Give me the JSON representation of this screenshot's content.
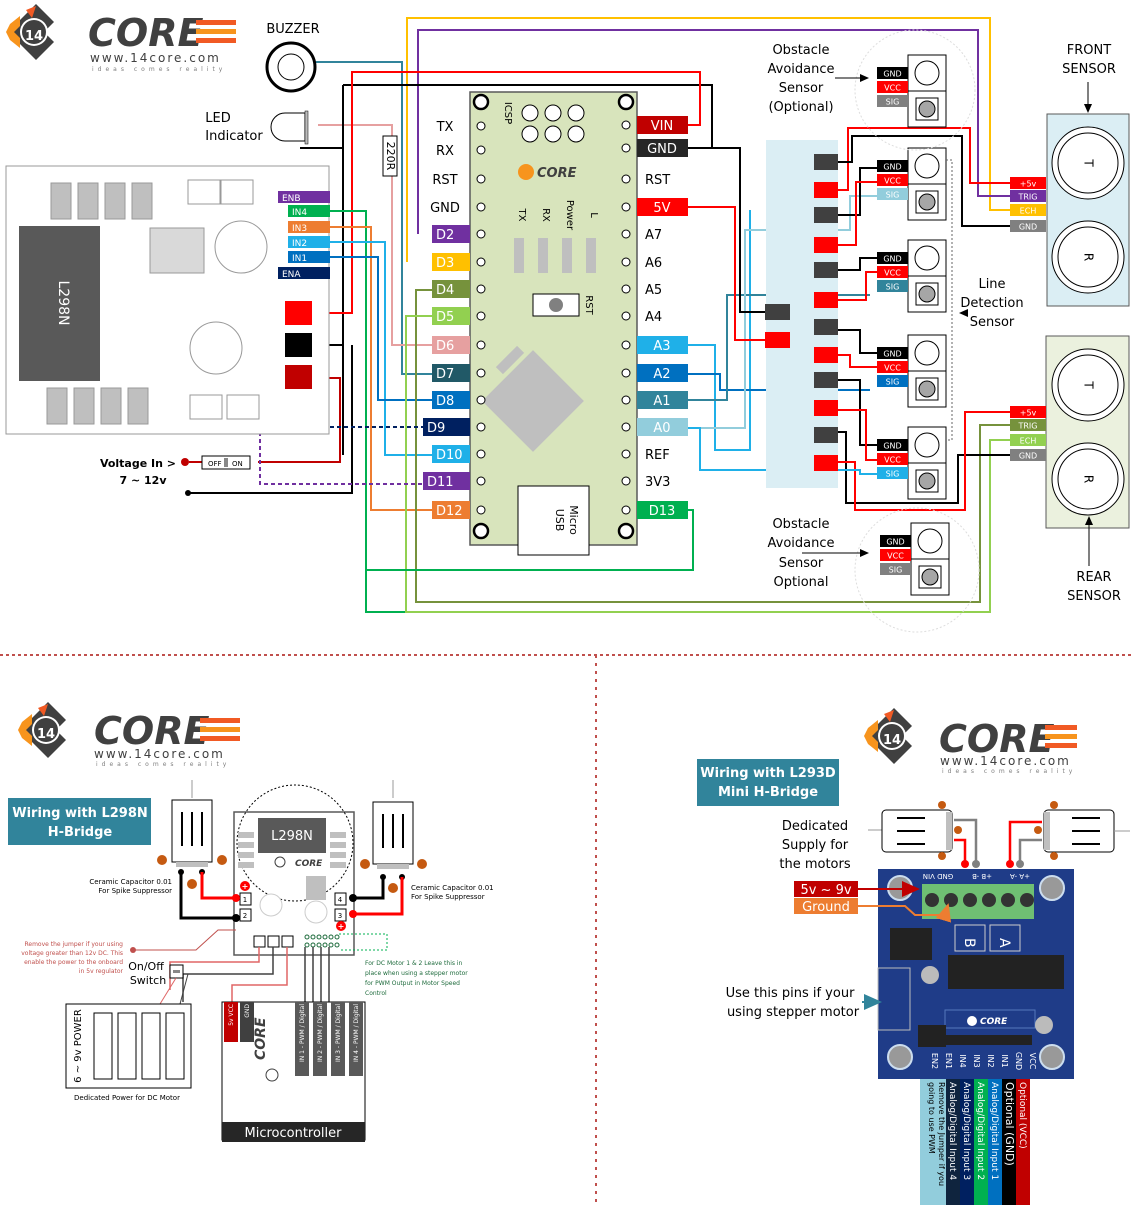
{
  "brand": {
    "name": "CORE",
    "prefix": "14",
    "url": "www.14core.com",
    "tagline": "ideas comes reality"
  },
  "top_diagram": {
    "buzzer_label": "BUZZER",
    "led_label_1": "LED",
    "led_label_2": "Indicator",
    "resistor_label": "220R",
    "driver_chip_label": "L298N",
    "driver_pins": [
      {
        "label": "ENB",
        "color": "#7030a0"
      },
      {
        "label": "IN4",
        "color": "#00b050"
      },
      {
        "label": "IN3",
        "color": "#ed7d31"
      },
      {
        "label": "IN2",
        "color": "#1fb0e8"
      },
      {
        "label": "IN1",
        "color": "#0070c0"
      },
      {
        "label": "ENA",
        "color": "#002060"
      }
    ],
    "voltage_in_1": "Voltage In >",
    "voltage_in_2": "7 ~ 12v",
    "switch_off": "OFF",
    "switch_on": "ON",
    "arduino": {
      "icsp": "ICSP",
      "left_plain": [
        "TX",
        "RX",
        "RST",
        "GND"
      ],
      "left_pins": [
        {
          "label": "D2",
          "color": "#7030a0"
        },
        {
          "label": "D3",
          "color": "#ffc000"
        },
        {
          "label": "D4",
          "color": "#76923c"
        },
        {
          "label": "D5",
          "color": "#92d050"
        },
        {
          "label": "D6",
          "color": "#e6a0a0"
        },
        {
          "label": "D7",
          "color": "#215967"
        },
        {
          "label": "D8",
          "color": "#0070c0"
        },
        {
          "label": "D9",
          "color": "#002060"
        },
        {
          "label": "D10",
          "color": "#1fb0e8"
        },
        {
          "label": "D11",
          "color": "#7030a0"
        },
        {
          "label": "D12",
          "color": "#ed7d31"
        }
      ],
      "right_pins": [
        {
          "label": "VIN",
          "color": "#c00000",
          "tagged": true
        },
        {
          "label": "GND",
          "color": "#262626",
          "tagged": true
        },
        {
          "label": "RST",
          "color": "",
          "tagged": false
        },
        {
          "label": "5V",
          "color": "#ff0000",
          "tagged": true
        },
        {
          "label": "A7",
          "color": "",
          "tagged": false
        },
        {
          "label": "A6",
          "color": "",
          "tagged": false
        },
        {
          "label": "A5",
          "color": "",
          "tagged": false
        },
        {
          "label": "A4",
          "color": "",
          "tagged": false
        },
        {
          "label": "A3",
          "color": "#1fb0e8",
          "tagged": true
        },
        {
          "label": "A2",
          "color": "#0070c0",
          "tagged": true
        },
        {
          "label": "A1",
          "color": "#31849b",
          "tagged": true
        },
        {
          "label": "A0",
          "color": "#92cddc",
          "tagged": true
        },
        {
          "label": "REF",
          "color": "",
          "tagged": false
        },
        {
          "label": "3V3",
          "color": "",
          "tagged": false
        },
        {
          "label": "D13",
          "color": "#00b050",
          "tagged": true
        }
      ],
      "leds": [
        "TX",
        "RX",
        "Power",
        "L"
      ],
      "rst_button": "RST",
      "usb_1": "Micro",
      "usb_2": "USB"
    },
    "obstacle_top": [
      "Obstacle",
      "Avoidance",
      "Sensor",
      "(Optional)"
    ],
    "obstacle_bottom": [
      "Obstacle",
      "Avoidance",
      "Sensor",
      "Optional"
    ],
    "line_detection": [
      "Line",
      "Detection",
      "Sensor"
    ],
    "sensor_pins": {
      "gnd": "GND",
      "vcc": "VCC",
      "sig": "SIG"
    },
    "front_sensor": [
      "FRONT",
      "SENSOR"
    ],
    "rear_sensor": [
      "REAR",
      "SENSOR"
    ],
    "ultrasonic_pins": [
      "+5v",
      "TRIG",
      "ECH",
      "GND"
    ],
    "ultrasonic_t": "T",
    "ultrasonic_r": "R"
  },
  "l298n_panel": {
    "title_1": "Wiring with L298N",
    "title_2": "H-Bridge",
    "chip": "L298N",
    "cap_note_1": "Ceramic Capacitor 0.01",
    "cap_note_2": "For Spike Suppressor",
    "terminals": [
      "1",
      "2",
      "4",
      "3"
    ],
    "jumper_note": [
      "Remove the jumper if your using",
      "voltage greater than 12v DC. This",
      "enable the power to the onboard",
      "in 5v regulator"
    ],
    "switch_label_1": "On/Off",
    "switch_label_2": "Switch",
    "battery_label": "6 ~ 9v POWER",
    "battery_caption": "Dedicated Power for DC Motor",
    "pwm_note": [
      "For DC Motor 1 & 2 Leave this in",
      "place  when using a stepper motor",
      "for PWM Output in Motor Speed",
      "Control"
    ],
    "mcu_pins": [
      "5v VCC",
      "GND",
      "IN 1 - PWM / Digital",
      "IN 2 - PWM / Digital",
      "IN 3 - PWM / Digital",
      "IN 4 - PWM / Digital"
    ],
    "mcu_label": "Microcontroller"
  },
  "l293d_panel": {
    "title_1": "Wiring with L293D",
    "title_2": "Mini H-Bridge",
    "supply_note": [
      "Dedicated",
      "Supply for",
      "the motors"
    ],
    "power_label": "5v ~ 9v",
    "ground_label": "Ground",
    "terminal_labels": [
      "GND VIN",
      "+B  -B",
      "+A  -A"
    ],
    "stepper_note_1": "Use this pins if your",
    "stepper_note_2": "using stepper motor",
    "header_pins": [
      "EN2",
      "EN1",
      "IN4",
      "IN3",
      "IN2",
      "IN1",
      "GND",
      "VCC"
    ],
    "wires": [
      {
        "label": "Remove the Jumper if you going to use PWM",
        "color": "#92cddc",
        "text": "#000"
      },
      {
        "label": "Analog/Digital Input 4",
        "color": "#0f243e",
        "text": "#fff"
      },
      {
        "label": "Analog/Digital Input 3",
        "color": "#002060",
        "text": "#fff"
      },
      {
        "label": "Analog/Digital Input 2",
        "color": "#00b050",
        "text": "#fff"
      },
      {
        "label": "Analog/Digital Input 1",
        "color": "#0070c0",
        "text": "#fff"
      },
      {
        "label": "Optional (GND)",
        "color": "#000000",
        "text": "#fff"
      },
      {
        "label": "Optional (VCC)",
        "color": "#c00000",
        "text": "#fff"
      }
    ]
  }
}
